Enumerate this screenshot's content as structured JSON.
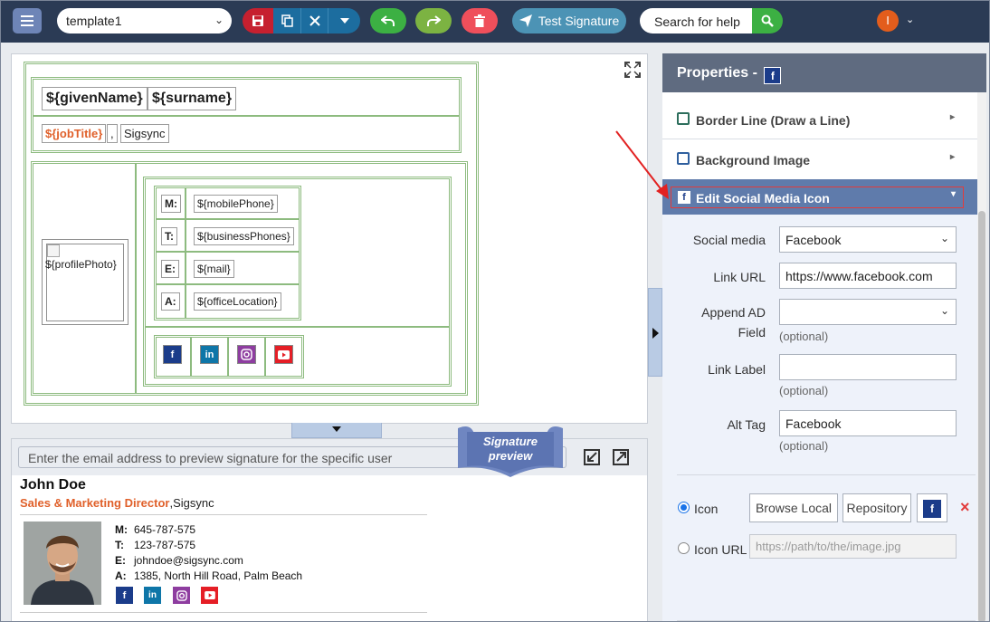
{
  "toolbar": {
    "template_name": "template1",
    "test_signature": "Test Signature",
    "search_placeholder": "Search for help",
    "user_initial": "I",
    "colors": {
      "bar": "#2b3b55",
      "save": "#c6202f",
      "copy": "#1c6d9f",
      "undo": "#3cb043",
      "redo": "#7cb342",
      "delete": "#ef4f5b",
      "test": "#4c93b5"
    }
  },
  "canvas": {
    "given_name": "${givenName}",
    "surname": "${surname}",
    "job_title": "${jobTitle}",
    "separator": ",",
    "company": "Sigsync",
    "profile_photo": "${profilePhoto}",
    "contacts": [
      {
        "label": "M:",
        "value": "${mobilePhone}"
      },
      {
        "label": "T:",
        "value": "${businessPhones}"
      },
      {
        "label": "E:",
        "value": "${mail}"
      },
      {
        "label": "A:",
        "value": "${officeLocation}"
      }
    ],
    "social_icons": [
      "facebook-icon",
      "linkedin-icon",
      "instagram-icon",
      "youtube-icon"
    ]
  },
  "preview": {
    "email_placeholder": "Enter the email address to preview signature for the specific user",
    "ribbon_line1": "Signature",
    "ribbon_line2": "preview",
    "name": "John Doe",
    "job_title": "Sales & Marketing Director",
    "company": ",Sigsync",
    "contacts": [
      {
        "label": "M:",
        "value": "645-787-575"
      },
      {
        "label": "T:",
        "value": "123-787-575"
      },
      {
        "label": "E:",
        "value": "johndoe@sigsync.com"
      },
      {
        "label": "A:",
        "value": "1385, North Hill Road, Palm Beach"
      }
    ]
  },
  "panel": {
    "title": "Properties -",
    "items": [
      {
        "label": "Border Line (Draw a Line)"
      },
      {
        "label": "Background Image"
      }
    ],
    "active_item": "Edit Social Media Icon",
    "form": {
      "social_media_label": "Social media",
      "social_media_value": "Facebook",
      "link_url_label": "Link URL",
      "link_url_value": "https://www.facebook.com",
      "append_ad_label_1": "Append AD",
      "append_ad_label_2": "Field",
      "append_ad_value": "",
      "optional": "(optional)",
      "link_label_label": "Link Label",
      "link_label_value": "",
      "alt_tag_label": "Alt Tag",
      "alt_tag_value": "Facebook",
      "icon_radio_label": "Icon",
      "browse_local": "Browse Local",
      "repository": "Repository",
      "icon_url_label": "Icon URL",
      "icon_url_placeholder": "https://path/to/the/image.jpg",
      "remove_mark": "×"
    }
  }
}
